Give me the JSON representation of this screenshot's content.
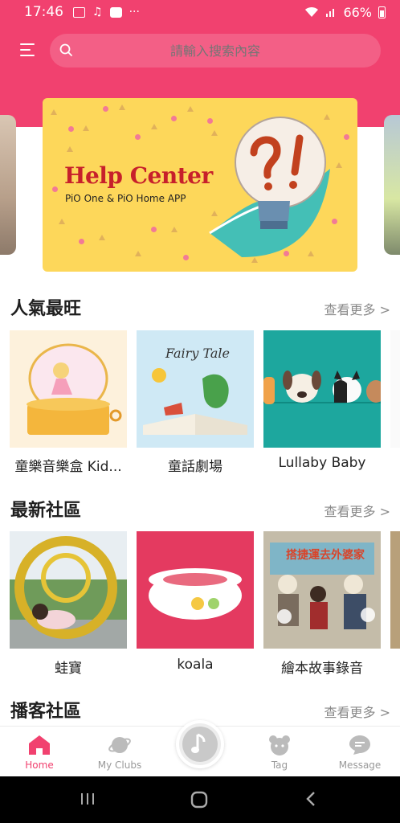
{
  "status_bar": {
    "time": "17:46",
    "more": "···",
    "battery": "66%"
  },
  "search": {
    "placeholder": "請輸入搜索內容"
  },
  "banner": {
    "title": "Help Center",
    "subtitle": "PiO One & PiO Home APP"
  },
  "sections": [
    {
      "title": "人氣最旺",
      "more": "查看更多 >",
      "items": [
        {
          "label": "童樂音樂盒 Kid..."
        },
        {
          "label": "童話劇場"
        },
        {
          "label": "Lullaby Baby"
        }
      ]
    },
    {
      "title": "最新社區",
      "more": "查看更多 >",
      "items": [
        {
          "label": "蛙寶"
        },
        {
          "label": "koala"
        },
        {
          "label": "繪本故事錄音"
        }
      ]
    },
    {
      "title": "播客社區",
      "more": "查看更多 >"
    }
  ],
  "artwork_text": {
    "fairy_tale": "Fairy Tale",
    "book_title": "搭捷運去外婆家"
  },
  "bottom_nav": [
    {
      "label": "Home",
      "icon": "home-icon",
      "active": true
    },
    {
      "label": "My Clubs",
      "icon": "planet-icon",
      "active": false
    },
    {
      "label": "",
      "icon": "music-note-icon",
      "active": false
    },
    {
      "label": "Tag",
      "icon": "bear-icon",
      "active": false
    },
    {
      "label": "Message",
      "icon": "chat-icon",
      "active": false
    }
  ],
  "colors": {
    "accent": "#f1416f",
    "banner_bg": "#fdd75a",
    "muted": "#999999"
  }
}
